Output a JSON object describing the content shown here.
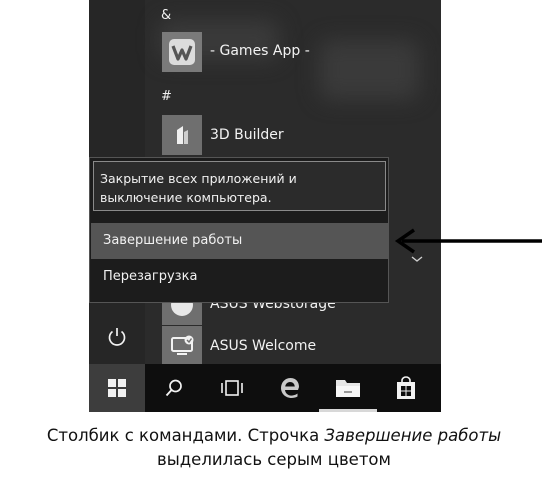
{
  "start_menu": {
    "groups": {
      "amp": "&",
      "hash": "#"
    },
    "apps": [
      {
        "name": "- Games App -",
        "icon": "games-app-icon"
      },
      {
        "name": "3D Builder",
        "icon": "3d-builder-icon"
      },
      {
        "name": "ASUS Webstorage",
        "icon": "asus-webstorage-icon"
      },
      {
        "name": "ASUS Welcome",
        "icon": "asus-welcome-icon"
      }
    ]
  },
  "power_menu": {
    "tooltip": "Закрытие всех приложений и выключение компьютера.",
    "items": [
      {
        "label": "Завершение работы",
        "highlighted": true
      },
      {
        "label": "Перезагрузка",
        "highlighted": false
      }
    ]
  },
  "taskbar": {
    "icons": [
      "windows-start-icon",
      "search-icon",
      "task-view-icon",
      "edge-icon",
      "file-explorer-icon",
      "store-icon"
    ]
  },
  "caption": {
    "line1_prefix": "Столбик с командами. Строчка ",
    "line1_emphasis": "Завершение работы",
    "line2": "выделилась серым цветом"
  },
  "colors": {
    "highlight": "#555555",
    "menu_bg": "#1c1c1c",
    "taskbar_bg": "#0e0e0e"
  }
}
